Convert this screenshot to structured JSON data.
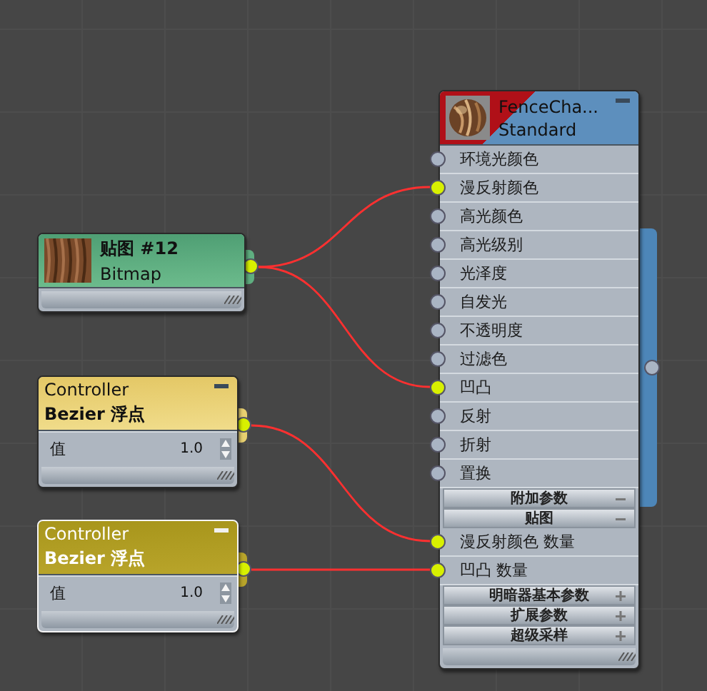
{
  "nodes": [
    {
      "kind": "material",
      "title": "FenceCha...",
      "subtitle": "Standard",
      "selected": false,
      "items": [
        {
          "kind": "slot",
          "label": "环境光颜色",
          "connected": false
        },
        {
          "kind": "slot",
          "label": "漫反射颜色",
          "connected": true
        },
        {
          "kind": "slot",
          "label": "高光颜色",
          "connected": false
        },
        {
          "kind": "slot",
          "label": "高光级别",
          "connected": false
        },
        {
          "kind": "slot",
          "label": "光泽度",
          "connected": false
        },
        {
          "kind": "slot",
          "label": "自发光",
          "connected": false
        },
        {
          "kind": "slot",
          "label": "不透明度",
          "connected": false
        },
        {
          "kind": "slot",
          "label": "过滤色",
          "connected": false
        },
        {
          "kind": "slot",
          "label": "凹凸",
          "connected": true
        },
        {
          "kind": "slot",
          "label": "反射",
          "connected": false
        },
        {
          "kind": "slot",
          "label": "折射",
          "connected": false
        },
        {
          "kind": "slot",
          "label": "置换",
          "connected": false
        },
        {
          "kind": "group",
          "label": "附加参数",
          "expanded": true
        },
        {
          "kind": "group",
          "label": "贴图",
          "expanded": true
        },
        {
          "kind": "slot",
          "label": "漫反射颜色 数量",
          "connected": true
        },
        {
          "kind": "slot",
          "label": "凹凸 数量",
          "connected": true
        },
        {
          "kind": "group",
          "label": "明暗器基本参数",
          "expanded": false
        },
        {
          "kind": "group",
          "label": "扩展参数",
          "expanded": false
        },
        {
          "kind": "group",
          "label": "超级采样",
          "expanded": false
        }
      ]
    },
    {
      "kind": "bitmap",
      "title": "贴图 #12",
      "subtitle": "Bitmap",
      "selected": false
    },
    {
      "kind": "controller",
      "title": "Controller",
      "subtitle": "Bezier 浮点",
      "selected": false,
      "param": {
        "label": "值",
        "value": "1.0"
      }
    },
    {
      "kind": "controller",
      "title": "Controller",
      "subtitle": "Bezier 浮点",
      "selected": true,
      "param": {
        "label": "值",
        "value": "1.0"
      }
    }
  ]
}
